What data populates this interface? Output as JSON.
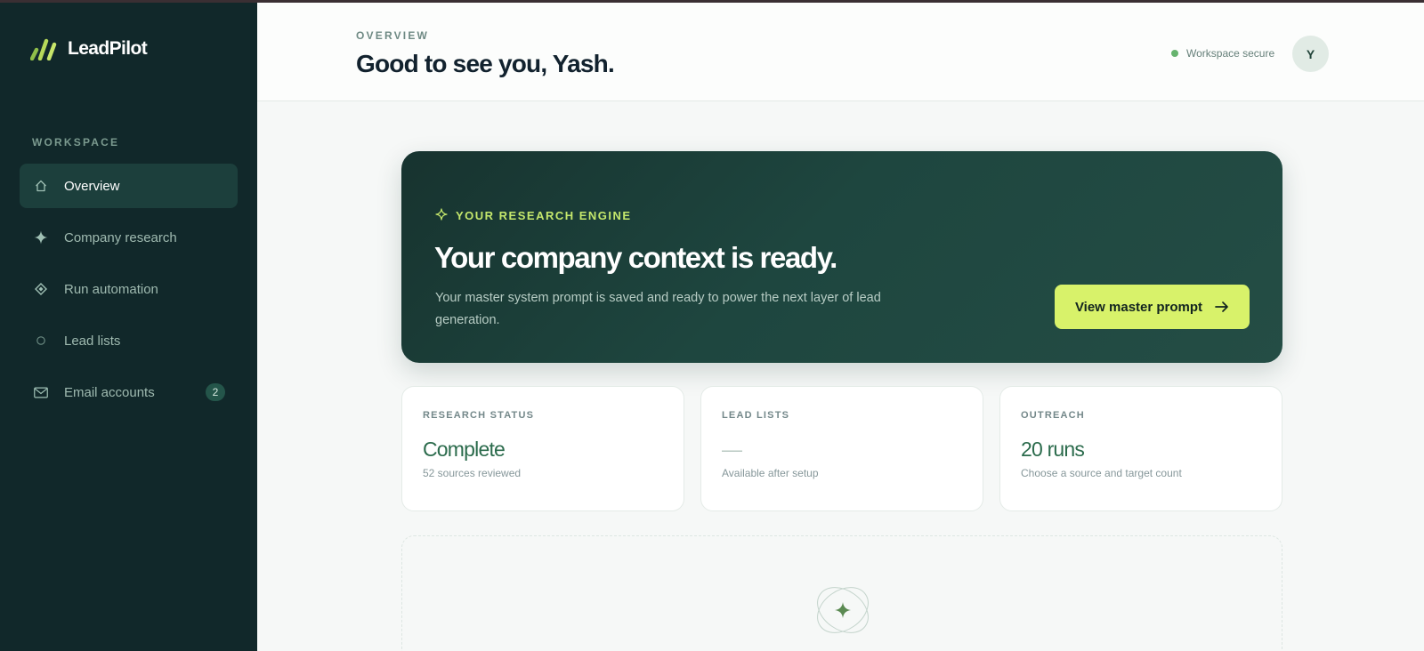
{
  "brand": {
    "name": "LeadPilot",
    "logo_icon": "bars-logo-icon",
    "colors": {
      "logo": "#b6d95a",
      "sidebar_bg": "#11282a",
      "accent": "#d8f26a"
    }
  },
  "sidebar": {
    "section_label": "WORKSPACE",
    "items": [
      {
        "label": "Overview",
        "icon": "home-icon",
        "active": true
      },
      {
        "label": "Company research",
        "icon": "sparkle-icon"
      },
      {
        "label": "Run automation",
        "icon": "diamond-icon"
      },
      {
        "label": "Lead lists",
        "icon": "circle-icon"
      },
      {
        "label": "Email accounts",
        "icon": "mail-icon",
        "badge": "2"
      }
    ]
  },
  "header": {
    "eyebrow": "OVERVIEW",
    "title": "Good to see you, Yash.",
    "status_text": "Workspace secure",
    "avatar_initial": "Y"
  },
  "hero": {
    "eyebrow": "YOUR RESEARCH ENGINE",
    "title": "Your company context is ready.",
    "description": "Your master system prompt is saved and ready to power the next layer of lead generation.",
    "button_label": "View master prompt"
  },
  "stats": [
    {
      "label": "RESEARCH STATUS",
      "value": "Complete",
      "sub": "52 sources reviewed"
    },
    {
      "label": "LEAD LISTS",
      "value": "—",
      "sub": "Available after setup"
    },
    {
      "label": "OUTREACH",
      "value": "20 runs",
      "sub": "Choose a source and target count"
    }
  ],
  "empty_state": {
    "icon": "orbit-sparkle-icon"
  }
}
